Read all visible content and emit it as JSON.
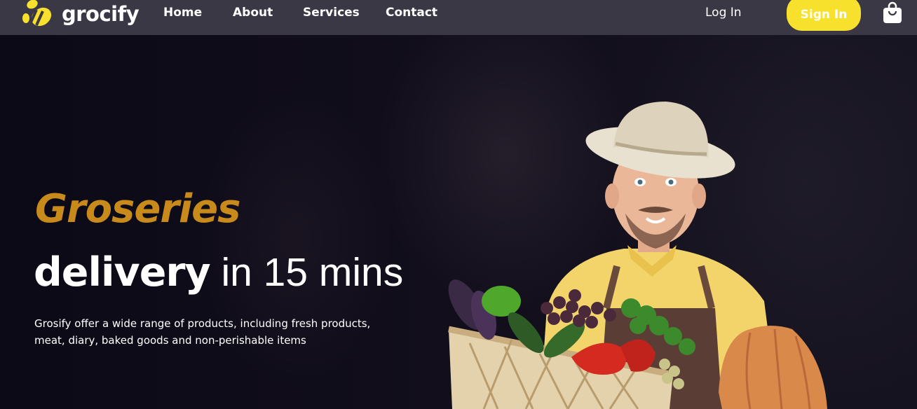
{
  "brand": {
    "name": "grocify",
    "accent": "#f7e12c"
  },
  "nav": {
    "links": [
      "Home",
      "About",
      "Services",
      "Contact"
    ],
    "login_label": "Log In",
    "signin_label": "Sign In",
    "cart_icon": "shopping-bag-icon"
  },
  "hero": {
    "title": "Groseries",
    "subtitle_bold": "delivery",
    "subtitle_light": " in 15 mins",
    "description": "Grosify offer a wide range of products, including fresh products, meat, diary, baked goods and non-perishable items",
    "title_color": "#c88a1a"
  }
}
